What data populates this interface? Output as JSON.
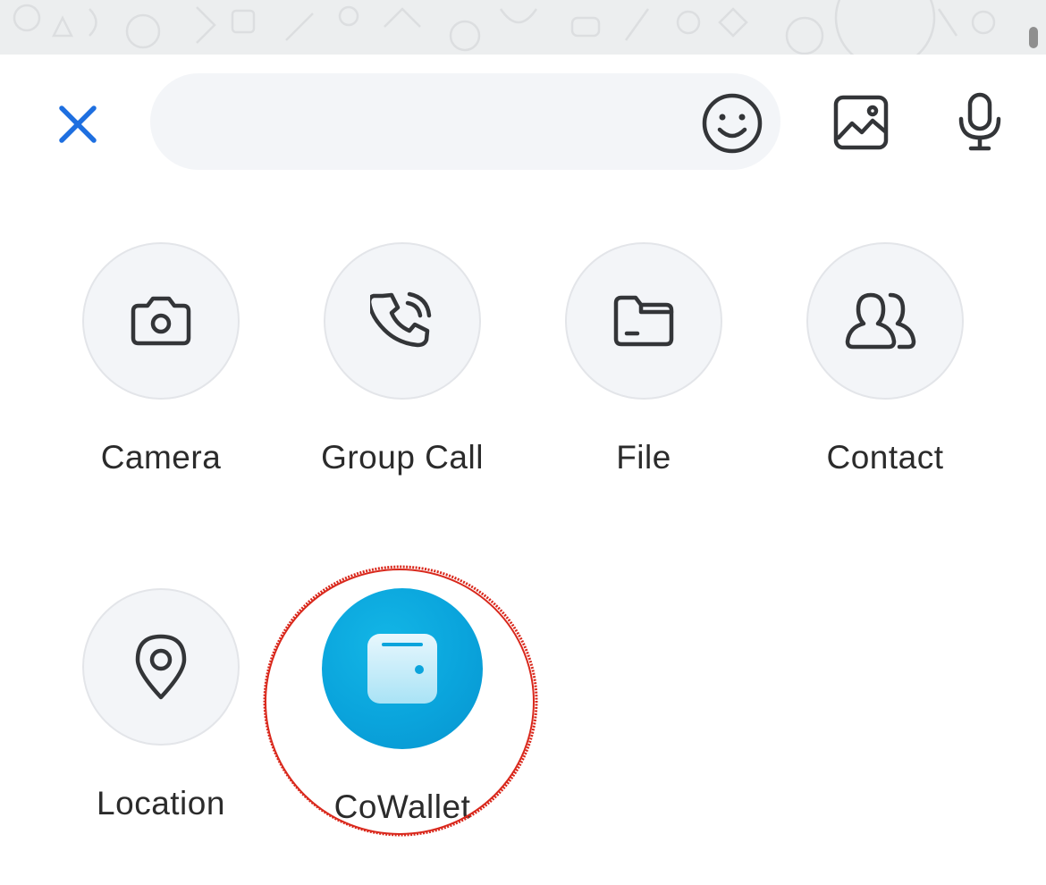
{
  "colors": {
    "accent": "#1e6fe0",
    "icon_stroke": "#333538",
    "circle_fill": "#f3f5f8",
    "wallet_blue": "#0aa4dc",
    "highlight_red": "#d9281c"
  },
  "input_bar": {
    "close_icon": "close-x-icon",
    "text_value": "",
    "emoji_icon": "smiley-icon",
    "image_icon": "image-icon",
    "mic_icon": "microphone-icon"
  },
  "actions": [
    {
      "label": "Camera",
      "icon": "camera-icon"
    },
    {
      "label": "Group Call",
      "icon": "phone-call-icon"
    },
    {
      "label": "File",
      "icon": "folder-icon"
    },
    {
      "label": "Contact",
      "icon": "contacts-icon"
    },
    {
      "label": "Location",
      "icon": "location-pin-icon"
    },
    {
      "label": "CoWallet",
      "icon": "wallet-icon"
    }
  ]
}
